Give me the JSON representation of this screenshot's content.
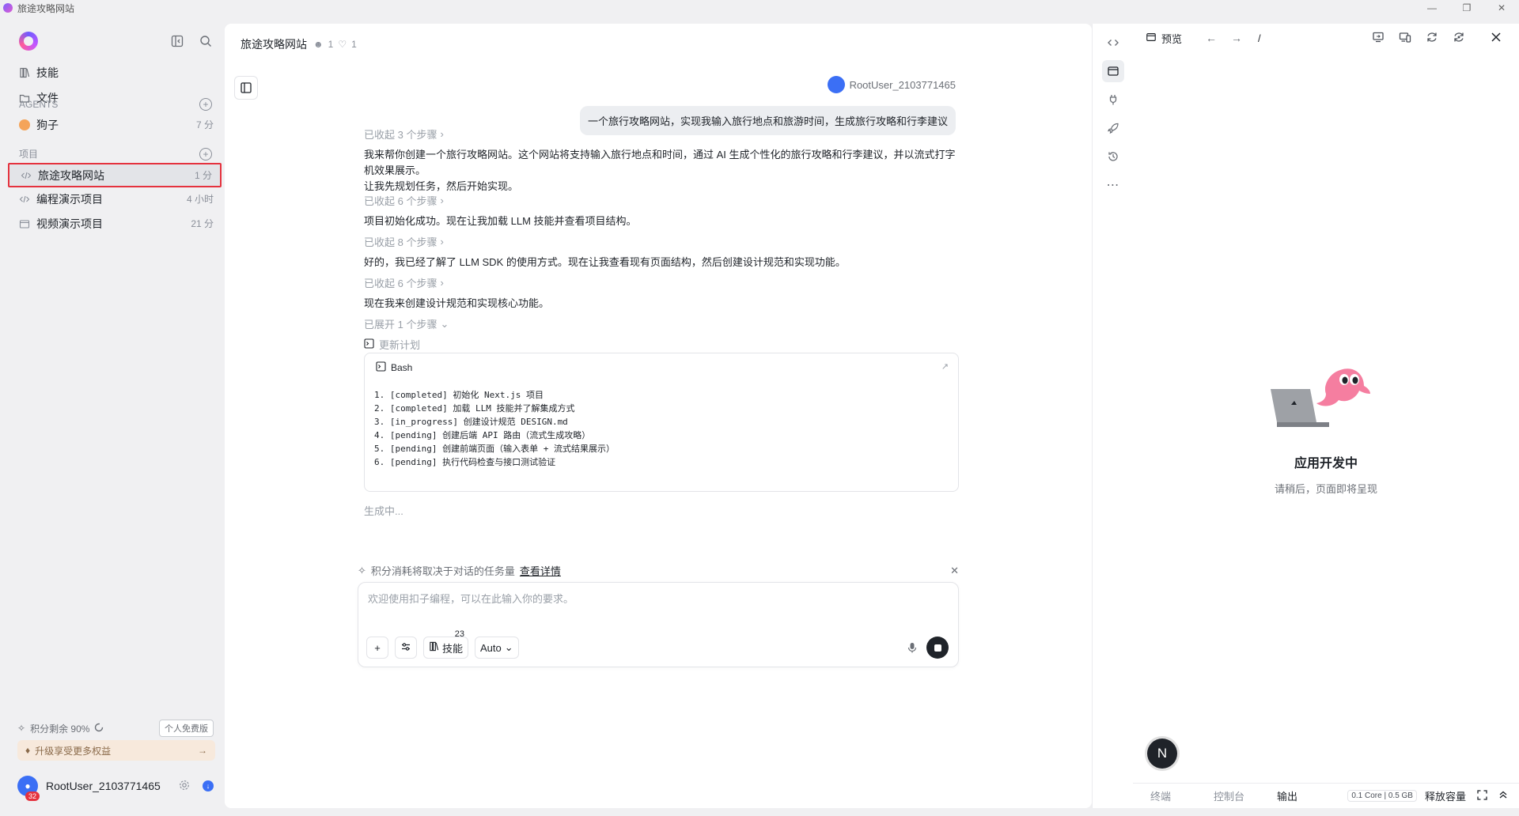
{
  "window": {
    "title": "旅途攻略网站"
  },
  "sidebar": {
    "nav": [
      {
        "label": "技能"
      },
      {
        "label": "文件"
      }
    ],
    "agents_header": "AGENTS",
    "agents": [
      {
        "name": "狗子",
        "time": "7 分"
      }
    ],
    "projects_header": "项目",
    "projects": [
      {
        "name": "旅途攻略网站",
        "time": "1 分"
      },
      {
        "name": "编程演示项目",
        "time": "4 小时"
      },
      {
        "name": "视频演示项目",
        "time": "21 分"
      }
    ],
    "credits_text": "积分剩余 90%",
    "plan_badge": "个人免费版",
    "upgrade_text": "升级享受更多权益",
    "user": {
      "name": "RootUser_2103771465",
      "badge_count": "32"
    }
  },
  "chat": {
    "title": "旅途攻略网站",
    "members_count": "1",
    "likes_count": "1",
    "user_label": "RootUser_2103771465",
    "user_message": "一个旅行攻略网站，实现我输入旅行地点和旅游时间，生成旅行攻略和行李建议",
    "messages": [
      {
        "steps": "已收起 3 个步骤",
        "text": "我来帮你创建一个旅行攻略网站。这个网站将支持输入旅行地点和时间，通过 AI 生成个性化的旅行攻略和行李建议，并以流式打字机效果展示。",
        "text2": "让我先规划任务，然后开始实现。"
      },
      {
        "steps": "已收起 6 个步骤",
        "text": "项目初始化成功。现在让我加载 LLM 技能并查看项目结构。"
      },
      {
        "steps": "已收起 8 个步骤",
        "text": "好的，我已经了解了 LLM SDK 的使用方式。现在让我查看现有页面结构，然后创建设计规范和实现功能。"
      },
      {
        "steps": "已收起 6 个步骤",
        "text": "现在我来创建设计规范和实现核心功能。"
      }
    ],
    "expanded_steps": "已展开 1 个步骤",
    "plan_label": "更新计划",
    "bash": {
      "title": "Bash",
      "lines": [
        "1. [completed] 初始化 Next.js 项目",
        "2. [completed] 加载 LLM 技能并了解集成方式",
        "3. [in_progress] 创建设计规范 DESIGN.md",
        "4. [pending] 创建后端 API 路由（流式生成攻略）",
        "5. [pending] 创建前端页面（输入表单 + 流式结果展示）",
        "6. [pending] 执行代码检查与接口测试验证"
      ]
    },
    "generating": "生成中...",
    "tip": {
      "text": "积分消耗将取决于对话的任务量",
      "link": "查看详情"
    },
    "input": {
      "placeholder": "欢迎使用扣子编程，可以在此输入你的要求。",
      "value": ""
    },
    "tools": {
      "skills_label": "技能",
      "skills_count": "23",
      "mode": "Auto"
    }
  },
  "preview": {
    "label": "预览",
    "path": "/",
    "title": "应用开发中",
    "subtitle": "请稍后，页面即将呈现",
    "badge": "N",
    "tabs": [
      "终端",
      "控制台",
      "输出"
    ],
    "spec": "0.1 Core | 0.5 GB",
    "release": "释放容量"
  },
  "colors": {
    "accent": "#3b6ff5",
    "highlight_border": "#e5323e",
    "upgrade_bg": "#f7e9dc"
  }
}
